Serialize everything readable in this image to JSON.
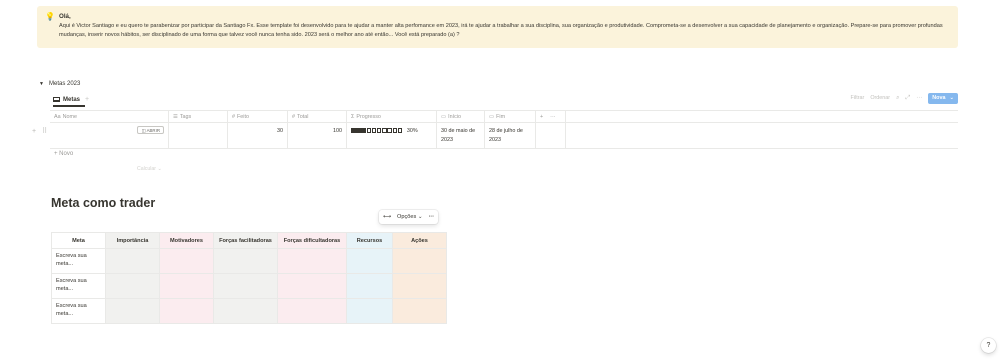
{
  "callout": {
    "icon": "lightbulb-icon",
    "title": "Olá,",
    "body": "Aqui é Victor Santiago e eu quero te parabenizar por participar da Santiago Fx. Esse template foi desenvolvido para te ajudar a manter alta perfomance em 2023, irá te ajudar a trabalhar a sua disciplina, sua organização e produtividade. Comprometa-se a desenvolver a sua capacidade de planejamento e organização. Prepare-se para promover profundas mudanças, inserir novos hábitos, ser disciplinado de uma forma que talvez você nunca tenha sido. 2023 será o melhor ano até então... Você está preparado (a) ?"
  },
  "database": {
    "name": "Metas 2023",
    "view_tab": "Metas",
    "toolbar": {
      "filter": "Filtrar",
      "sort": "Ordenar",
      "new_button": "Nova"
    },
    "columns": [
      {
        "icon": "Aa",
        "label": "Nome"
      },
      {
        "icon": "☰",
        "label": "Tags"
      },
      {
        "icon": "#",
        "label": "Feito"
      },
      {
        "icon": "#",
        "label": "Total"
      },
      {
        "icon": "Σ",
        "label": "Progresso"
      },
      {
        "icon": "▭",
        "label": "Início"
      },
      {
        "icon": "▭",
        "label": "Fim"
      }
    ],
    "rows": [
      {
        "nome": "",
        "open_label": "ABRIR",
        "tags": "",
        "feito": "30",
        "total": "100",
        "progress": 0.3,
        "progress_text": "30%",
        "inicio": "30 de maio de 2023",
        "fim": "28 de julho de 2023"
      }
    ],
    "new_row_label": "+ Novo",
    "calculate_label": "Calcular"
  },
  "trader": {
    "title": "Meta como trader",
    "options_label": "Opções",
    "headers": [
      "Meta",
      "Importância",
      "Motivadores",
      "Forças facilitadoras",
      "Forças dificultadoras",
      "Recursos",
      "Ações"
    ],
    "rows": [
      [
        "Escreva sua meta...",
        "",
        "",
        "",
        "",
        "",
        ""
      ],
      [
        "Escreva sua meta...",
        "",
        "",
        "",
        "",
        "",
        ""
      ],
      [
        "Escreva sua meta...",
        "",
        "",
        "",
        "",
        "",
        ""
      ]
    ]
  },
  "help_label": "?"
}
